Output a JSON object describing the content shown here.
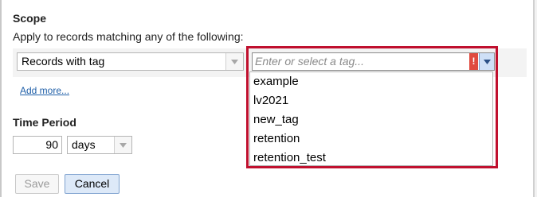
{
  "scope": {
    "title": "Scope",
    "description": "Apply to records matching any of the following:",
    "rule_type_value": "Records with tag",
    "tag_input_placeholder": "Enter or select a tag...",
    "warning_mark": "!",
    "add_more_link": "Add more...",
    "tag_options": [
      "example",
      "lv2021",
      "new_tag",
      "retention",
      "retention_test"
    ]
  },
  "time_period": {
    "title": "Time Period",
    "amount": "90",
    "unit_value": "days"
  },
  "actions": {
    "save_label": "Save",
    "cancel_label": "Cancel"
  },
  "colors": {
    "highlight": "#c0102e",
    "link": "#1f5fa8",
    "warning": "#e04a3f"
  }
}
